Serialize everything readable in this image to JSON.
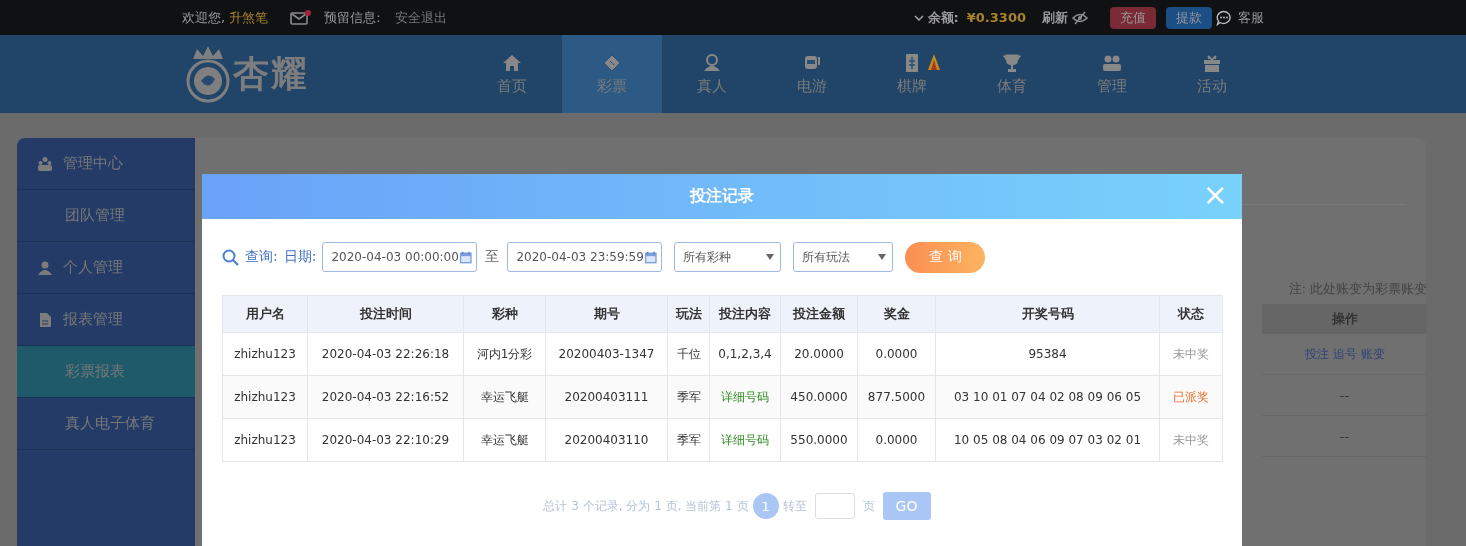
{
  "top_bar": {
    "welcome": "欢迎您,",
    "username": "升煞笔",
    "mail_unread": true,
    "reserved_info": "预留信息:",
    "logout": "安全退出",
    "balance_label": "余额:",
    "balance": "¥0.3300",
    "refresh": "刷新",
    "deposit": "充值",
    "withdraw": "提款",
    "service": "客服"
  },
  "header": {
    "logo_text": "杏耀",
    "nav": [
      {
        "label": "首页",
        "selected": false
      },
      {
        "label": "彩票",
        "selected": true
      },
      {
        "label": "真人",
        "selected": false
      },
      {
        "label": "电游",
        "selected": false
      },
      {
        "label": "棋牌",
        "selected": false
      },
      {
        "label": "体育",
        "selected": false
      },
      {
        "label": "管理",
        "selected": false
      },
      {
        "label": "活动",
        "selected": false
      }
    ]
  },
  "sidebar": {
    "items": [
      {
        "label": "管理中心",
        "kind": "section",
        "selected": false
      },
      {
        "label": "团队管理",
        "kind": "link",
        "selected": false
      },
      {
        "label": "个人管理",
        "kind": "section",
        "selected": false
      },
      {
        "label": "报表管理",
        "kind": "section",
        "selected": false
      },
      {
        "label": "彩票报表",
        "kind": "link",
        "selected": true
      },
      {
        "label": "真人电子体育",
        "kind": "link",
        "selected": false
      }
    ]
  },
  "page": {
    "note": "注: 此处账变为彩票账变",
    "table": {
      "columns": [
        "操作"
      ],
      "rows": [
        {
          "actions": [
            "投注",
            "追号",
            "账变"
          ]
        },
        {
          "text": "--"
        },
        {
          "text": "--"
        }
      ]
    }
  },
  "modal": {
    "title": "投注记录",
    "close": "×",
    "filter": {
      "query_label": "查询:",
      "date_label": "日期:",
      "date_from": "2020-04-03 00:00:00",
      "to_label": "至",
      "date_to": "2020-04-03 23:59:59",
      "lottery_select": "所有彩种",
      "play_select": "所有玩法",
      "query_button": "查 询"
    },
    "table": {
      "columns": [
        "用户名",
        "投注时间",
        "彩种",
        "期号",
        "玩法",
        "投注内容",
        "投注金额",
        "奖金",
        "开奖号码",
        "状态"
      ],
      "rows": [
        {
          "user": "zhizhu123",
          "time": "2020-04-03 22:26:18",
          "lottery": "河内1分彩",
          "issue": "20200403-1347",
          "play": "千位",
          "content": {
            "text": "0,1,2,3,4",
            "link": false
          },
          "amount": "20.0000",
          "prize": "0.0000",
          "numbers": "95384",
          "status": {
            "text": "未中奖",
            "kind": "lost"
          }
        },
        {
          "user": "zhizhu123",
          "time": "2020-04-03 22:16:52",
          "lottery": "幸运飞艇",
          "issue": "20200403111",
          "play": "季军",
          "content": {
            "text": "详细号码",
            "link": true
          },
          "amount": "450.0000",
          "prize": "877.5000",
          "numbers": "03 10 01 07 04 02 08 09 06 05",
          "status": {
            "text": "已派奖",
            "kind": "paid"
          }
        },
        {
          "user": "zhizhu123",
          "time": "2020-04-03 22:10:29",
          "lottery": "幸运飞艇",
          "issue": "20200403110",
          "play": "季军",
          "content": {
            "text": "详细号码",
            "link": true
          },
          "amount": "550.0000",
          "prize": "0.0000",
          "numbers": "10 05 08 04 06 09 07 03 02 01",
          "status": {
            "text": "未中奖",
            "kind": "lost"
          }
        }
      ]
    },
    "pagination": {
      "summary": "总计 3 个记录, 分为 1 页, 当前第 1 页",
      "pages": [
        {
          "label": "1",
          "selected": true
        }
      ],
      "goto_label": "转至",
      "page_unit": "页",
      "go": "GO"
    }
  }
}
